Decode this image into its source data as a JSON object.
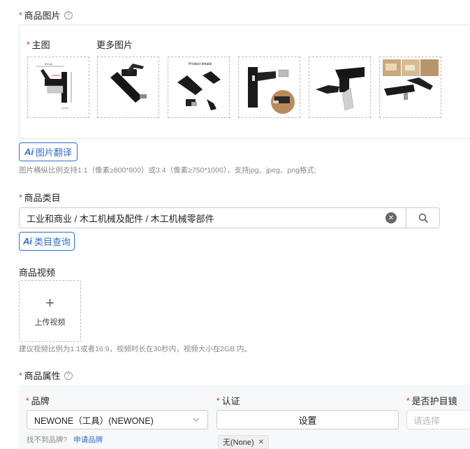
{
  "images_section": {
    "label": "商品图片",
    "main_image_label": "主图",
    "more_images_label": "更多图片",
    "thumbnails": [
      {
        "name": "main-image",
        "caption": ""
      },
      {
        "name": "more-image-1",
        "caption": ""
      },
      {
        "name": "more-image-2",
        "caption": "Product details"
      },
      {
        "name": "more-image-3",
        "caption": ""
      },
      {
        "name": "more-image-4",
        "caption": ""
      },
      {
        "name": "more-image-5",
        "caption": ""
      }
    ],
    "ai_translate_button": "图片翻译",
    "ai_badge": "Ai",
    "hint": "图片横纵比例支持1:1（像素≥800*800）或3:4（像素≥750*1000），支持jpg、jpeg、png格式;"
  },
  "category_section": {
    "label": "商品类目",
    "value": "工业和商业 / 木工机械及配件 / 木工机械零部件",
    "ai_query_button": "类目查询",
    "ai_badge": "Ai"
  },
  "video_section": {
    "label": "商品视频",
    "upload_label": "上传视频",
    "upload_glyph": "+",
    "hint": "建议视频比例为1:1或者16:9，视频时长在30秒内，视频大小在2GB 内。"
  },
  "attributes_section": {
    "label": "商品属性",
    "brand": {
      "label": "品牌",
      "value": "NEWONE（工具）(NEWONE)",
      "not_found_text": "找不到品牌?",
      "apply_link": "申请品牌"
    },
    "certification": {
      "label": "认证",
      "button": "设置",
      "tag": "无(None)",
      "tag_close": "✕"
    },
    "eye_protection": {
      "label": "是否护目镜",
      "placeholder": "请选择"
    }
  }
}
